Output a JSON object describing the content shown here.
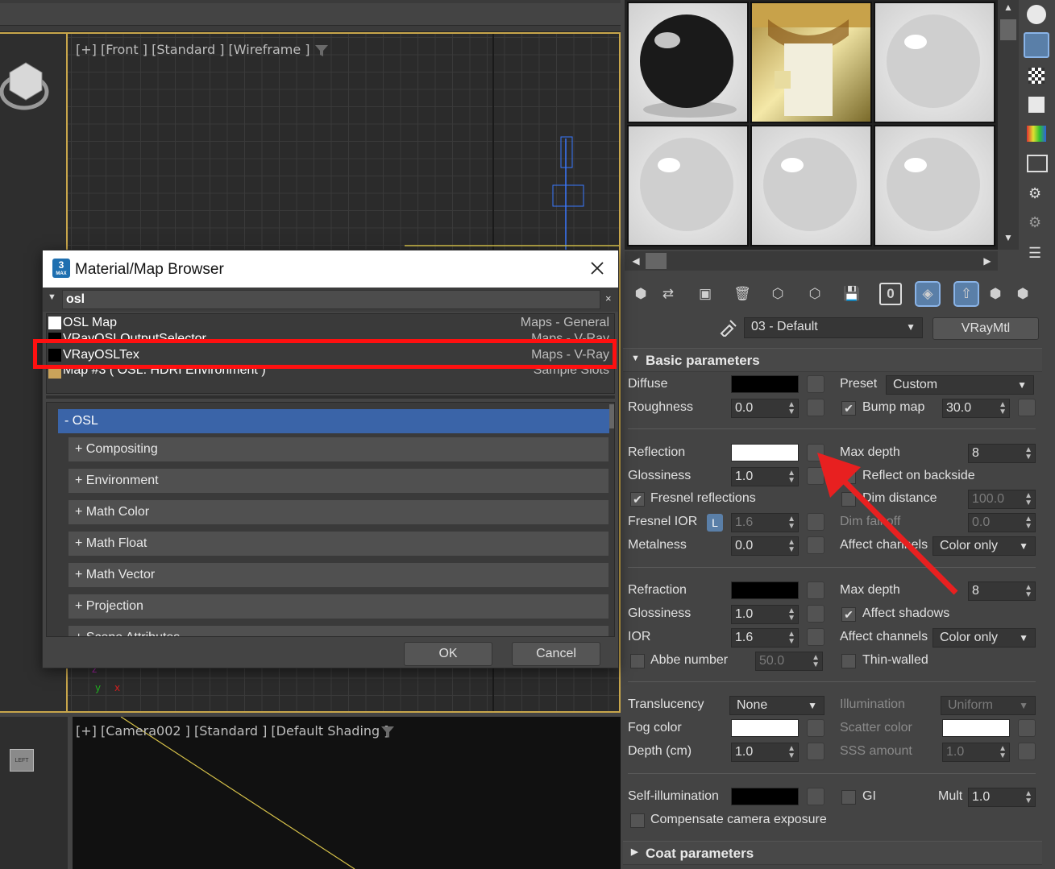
{
  "viewport_front": {
    "label": "[+] [Front ] [Standard ] [Wireframe ]"
  },
  "viewport_camera": {
    "label": "[+] [Camera002 ] [Standard ] [Default Shading ]"
  },
  "viewcube_left": {
    "label": "LEFT"
  },
  "material_editor": {
    "material_name": "03 - Default",
    "material_type": "VRayMtl"
  },
  "basic_params": {
    "title": "Basic parameters",
    "diffuse_label": "Diffuse",
    "preset_label": "Preset",
    "preset_value": "Custom",
    "roughness_label": "Roughness",
    "roughness_value": "0.0",
    "bump_label": "Bump map",
    "bump_value": "30.0",
    "reflection_label": "Reflection",
    "max_depth_label": "Max depth",
    "refl_max_depth": "8",
    "glossiness_label": "Glossiness",
    "refl_glossiness": "1.0",
    "reflect_backside_label": "Reflect on backside",
    "fresnel_label": "Fresnel reflections",
    "dim_distance_label": "Dim distance",
    "dim_distance_value": "100.0",
    "fresnel_ior_label": "Fresnel IOR",
    "fresnel_lock": "L",
    "fresnel_ior_value": "1.6",
    "dim_falloff_label": "Dim fall off",
    "dim_falloff_value": "0.0",
    "metalness_label": "Metalness",
    "metalness_value": "0.0",
    "affect_channels_label": "Affect channels",
    "refl_affect_channels": "Color only",
    "refraction_label": "Refraction",
    "refr_max_depth": "8",
    "refr_glossiness": "1.0",
    "affect_shadows_label": "Affect shadows",
    "ior_label": "IOR",
    "ior_value": "1.6",
    "refr_affect_channels": "Color only",
    "abbe_label": "Abbe number",
    "abbe_value": "50.0",
    "thin_walled_label": "Thin-walled",
    "translucency_label": "Translucency",
    "translucency_value": "None",
    "illumination_label": "Illumination",
    "illumination_value": "Uniform",
    "fog_color_label": "Fog color",
    "scatter_color_label": "Scatter color",
    "depth_label": "Depth (cm)",
    "depth_value": "1.0",
    "sss_label": "SSS amount",
    "sss_value": "1.0",
    "self_illum_label": "Self-illumination",
    "gi_label": "GI",
    "mult_label": "Mult",
    "mult_value": "1.0",
    "compensate_label": "Compensate camera exposure"
  },
  "coat_params": {
    "title": "Coat parameters"
  },
  "browser": {
    "title": "Material/Map Browser",
    "search_value": "osl",
    "results": [
      {
        "name": "OSL Map",
        "category": "Maps - General",
        "swatch": "#ffffff"
      },
      {
        "name": "VRayOSLOutputSelector",
        "category": "Maps - V-Ray",
        "swatch": "#000000"
      },
      {
        "name": "VRayOSLTex",
        "category": "Maps - V-Ray",
        "swatch": "#000000"
      },
      {
        "name": "Map #3  ( OSL: HDRI Environment )",
        "category": "Sample Slots",
        "swatch": "#caa35a"
      }
    ],
    "group": "- OSL",
    "categories": [
      "+ Compositing",
      "+ Environment",
      "+ Math Color",
      "+ Math Float",
      "+ Math Vector",
      "+ Projection",
      "+ Scene Attributes"
    ],
    "ok_label": "OK",
    "cancel_label": "Cancel"
  },
  "colors": {
    "highlight_box": "#ff1010",
    "arrow": "#e82020",
    "selection_blue": "#3a64a8",
    "viewport_border": "#c8a64b"
  }
}
